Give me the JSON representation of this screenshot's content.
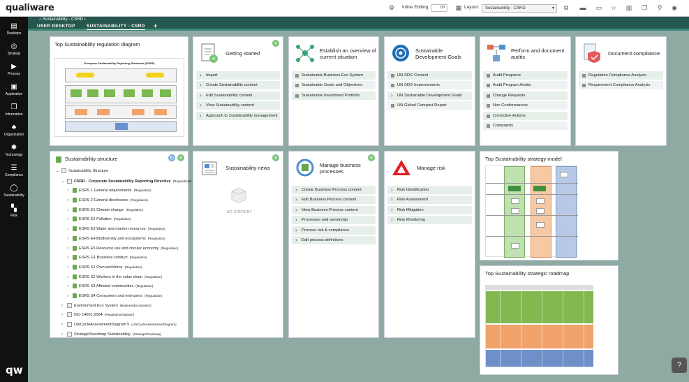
{
  "app": {
    "logo": "qualiware",
    "logo_short": "qw"
  },
  "breadcrumb": "Sustainability - CSRD",
  "toolbar": {
    "inline_editing_label": "Inline Editing:",
    "inline_editing_value": "Off",
    "layout_label": "Layout:",
    "layout_value": "Sustainability - CSRD"
  },
  "sidebar": {
    "items": [
      {
        "label": "Desktops",
        "icon": "desktop-icon"
      },
      {
        "label": "Strategy",
        "icon": "strategy-icon"
      },
      {
        "label": "Process",
        "icon": "process-icon"
      },
      {
        "label": "Application",
        "icon": "application-icon"
      },
      {
        "label": "Information",
        "icon": "information-icon"
      },
      {
        "label": "Organization",
        "icon": "organization-icon"
      },
      {
        "label": "Technology",
        "icon": "technology-icon"
      },
      {
        "label": "Compliance",
        "icon": "compliance-icon"
      },
      {
        "label": "Sustainability",
        "icon": "sustainability-icon"
      },
      {
        "label": "Risk",
        "icon": "risk-icon"
      }
    ]
  },
  "tabs": [
    {
      "label": "USER DESKTOP"
    },
    {
      "label": "SUSTAINABILITY - CSRD"
    },
    {
      "label": "+"
    }
  ],
  "cards": {
    "regulation": {
      "title": "Top Sustainability regulation diagram",
      "diagram_title": "European Sustainability Reporting Standards (ESRS)"
    },
    "getting_started": {
      "title": "Getting started",
      "items": [
        "Import",
        "Create Sustainability content",
        "Edit Sustainability content",
        "View Sustainability content",
        "Approach to Sustainability management"
      ]
    },
    "overview": {
      "title": "Establish an overview of current situation",
      "items": [
        "Sustainable Business Eco System",
        "Sustainable Goals and Objectives",
        "Sustainable Investment Portfolio"
      ]
    },
    "sdg": {
      "title": "Sustainable Development Goals",
      "items": [
        "UN SDG Context",
        "UN SDG Improvements",
        "UN Sustainable Development Goals",
        "UN Global Compact Report"
      ]
    },
    "audits": {
      "title": "Perform and document audits",
      "items": [
        "Audit Programs",
        "Audit Program Audits",
        "Change Requests",
        "Non Conformances",
        "Corrective Actions",
        "Complaints"
      ]
    },
    "compliance": {
      "title": "Document compliance",
      "items": [
        "Regulation Compliance Analysis",
        "Requirement Compliance Analysis"
      ]
    },
    "structure": {
      "title": "Sustainability structure",
      "tree": [
        {
          "label": "Sustainability Structure",
          "tag": "",
          "level": 0,
          "kind": "folder"
        },
        {
          "label": "CSRD - Corporate Sustainability Reporting Directive",
          "tag": "(RegulationD...",
          "level": 1,
          "kind": "doc",
          "bold": true
        },
        {
          "label": "ESRS 1 General requirements",
          "tag": "(Regulation)",
          "level": 2,
          "kind": "esrs"
        },
        {
          "label": "ESRS 2 General disclosures",
          "tag": "(Regulation)",
          "level": 2,
          "kind": "esrs"
        },
        {
          "label": "ESRS E1 Climate change",
          "tag": "(Regulation)",
          "level": 2,
          "kind": "esrs"
        },
        {
          "label": "ESRS E2 Pollution",
          "tag": "(Regulation)",
          "level": 2,
          "kind": "esrs"
        },
        {
          "label": "ESRS E3 Water and marine resources",
          "tag": "(Regulation)",
          "level": 2,
          "kind": "esrs"
        },
        {
          "label": "ESRS E4 Biodiversity and ecosystems",
          "tag": "(Regulation)",
          "level": 2,
          "kind": "esrs"
        },
        {
          "label": "ESRS E5 Resource use and circular economy",
          "tag": "(Regulation)",
          "level": 2,
          "kind": "esrs"
        },
        {
          "label": "ESRS G1 Business conduct",
          "tag": "(Regulation)",
          "level": 2,
          "kind": "esrs"
        },
        {
          "label": "ESRS S1 Own workforce",
          "tag": "(Regulation)",
          "level": 2,
          "kind": "esrs"
        },
        {
          "label": "ESRS S2 Workers in the value chain",
          "tag": "(Regulation)",
          "level": 2,
          "kind": "esrs"
        },
        {
          "label": "ESRS S3 Affected communities",
          "tag": "(Regulation)",
          "level": 2,
          "kind": "esrs"
        },
        {
          "label": "ESRS S4 Consumers and end-users",
          "tag": "(Regulation)",
          "level": 2,
          "kind": "esrs"
        },
        {
          "label": "Environment Eco System",
          "tag": "(BusinessEcoSystem)",
          "level": 1,
          "kind": "doc"
        },
        {
          "label": "ISO 14001:2004",
          "tag": "(RegulationDiagram)",
          "level": 1,
          "kind": "doc"
        },
        {
          "label": "LifeCycleAssessmentDiagram 5",
          "tag": "(LifeCycleAssessmentDiagram)",
          "level": 1,
          "kind": "doc"
        },
        {
          "label": "StrategicRoadmap Sustainability",
          "tag": "(StrategicRoadmap)",
          "level": 1,
          "kind": "doc"
        }
      ]
    },
    "news": {
      "title": "Sustainability news",
      "empty": "NO CONTENT"
    },
    "bpm": {
      "title": "Manage business processes",
      "items": [
        "Create Business Process content",
        "Edit Business Process content",
        "View Business Process content",
        "Processes and ownership",
        "Process risk & compliance",
        "Edit process definitions"
      ]
    },
    "risk": {
      "title": "Manage risk",
      "items": [
        "Risk Identification",
        "Risk Assessment",
        "Risk Mitigation",
        "Risk Monitoring"
      ]
    },
    "strategy": {
      "title": "Top Sustainability strategy model"
    },
    "roadmap": {
      "title": "Top Sustainability strategic roadmap"
    }
  },
  "colors": {
    "tabbar": "#26574f",
    "accent": "#3d8a78",
    "list_bg": "#e6efe9",
    "plus": "#7fc47f",
    "sdg_blue": "#1f6fb5",
    "risk_red": "#e02020"
  }
}
